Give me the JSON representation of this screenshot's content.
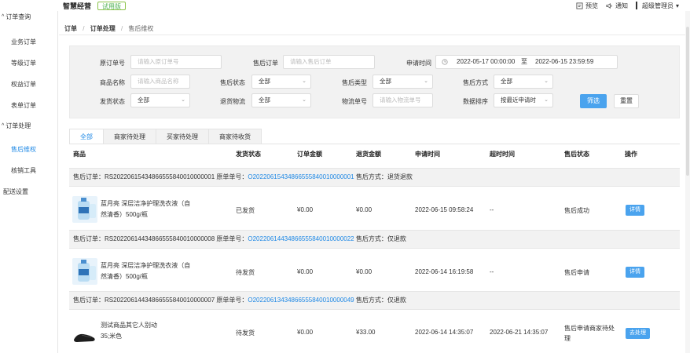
{
  "header": {
    "brand": "智慧经营",
    "trial_badge": "试用版",
    "preview": "预览",
    "notify": "通知",
    "user": "超级管理员",
    "caret": "▾"
  },
  "sidebar": {
    "groups": [
      {
        "label": "订单查询",
        "caret": "^"
      },
      {
        "label": "订单处理",
        "caret": "^"
      }
    ],
    "items_order_query": [
      "业务订单",
      "等级订单",
      "权益订单",
      "表单订单"
    ],
    "items_order_process": [
      "售后维权",
      "核销工具"
    ],
    "active": "售后维权",
    "extra": "配送设置"
  },
  "breadcrumb": {
    "level1": "订单",
    "level2": "订单处理",
    "level3": "售后维权",
    "separator": "/"
  },
  "filters": {
    "original_order_label": "原订单号",
    "original_order_placeholder": "请输入原订单号",
    "aftersale_order_label": "售后订单",
    "aftersale_order_placeholder": "请输入售后订单",
    "apply_time_label": "申请时间",
    "date_start": "2022-05-17 00:00:00",
    "date_sep": "至",
    "date_end": "2022-06-15 23:59:59",
    "product_name_label": "商品名称",
    "product_name_placeholder": "请输入商品名称",
    "aftersale_status_label": "售后状态",
    "aftersale_status_value": "全部",
    "aftersale_type_label": "售后类型",
    "aftersale_type_value": "全部",
    "aftersale_method_label": "售后方式",
    "aftersale_method_value": "全部",
    "ship_status_label": "发货状态",
    "ship_status_value": "全部",
    "return_logistics_label": "退货物流",
    "return_logistics_value": "全部",
    "logistics_no_label": "物流单号",
    "logistics_no_placeholder": "请输入物流单号",
    "sort_label": "数据排序",
    "sort_value": "按最近申请时",
    "filter_button": "筛选",
    "reset_button": "重置",
    "chevron": "⌄"
  },
  "tabs": [
    "全部",
    "商家待处理",
    "买家待处理",
    "商家待收货"
  ],
  "table": {
    "headers": [
      "商品",
      "发货状态",
      "订单金额",
      "退货金额",
      "申请时间",
      "超时时间",
      "售后状态",
      "操作"
    ],
    "groups": [
      {
        "aftersale_label": "售后订单：",
        "aftersale_no": "RS20220615434866555840010000001",
        "orig_label": "原单单号：",
        "orig_no": "O20220615434866555840010000001",
        "method_label": "售后方式：",
        "method": "退货退款",
        "product": "蓝月亮 深层洁净护理洗衣液（自然清香）500g/瓶",
        "ship_status": "已发货",
        "order_amount": "¥0.00",
        "refund_amount": "¥0.00",
        "apply_time": "2022-06-15 09:58:24",
        "timeout": "--",
        "status": "售后成功",
        "action": "详情"
      },
      {
        "aftersale_label": "售后订单：",
        "aftersale_no": "RS20220614434866555840010000008",
        "orig_label": "原单单号：",
        "orig_no": "O20220614434866555840010000022",
        "method_label": "售后方式：",
        "method": "仅退款",
        "product": "蓝月亮 深层洁净护理洗衣液（自然清香）500g/瓶",
        "ship_status": "待发货",
        "order_amount": "¥0.00",
        "refund_amount": "¥0.00",
        "apply_time": "2022-06-14 16:19:58",
        "timeout": "--",
        "status": "售后申请",
        "action": "详情"
      },
      {
        "aftersale_label": "售后订单：",
        "aftersale_no": "RS20220614434866555840010000007",
        "orig_label": "原单单号：",
        "orig_no": "O20220613434866555840010000049",
        "method_label": "售后方式：",
        "method": "仅退款",
        "product": "测试商品其它人别动",
        "product_spec": "35;米色",
        "ship_status": "待发货",
        "order_amount": "¥0.00",
        "refund_amount": "¥33.00",
        "apply_time": "2022-06-14 14:35:07",
        "timeout": "2022-06-21 14:35:07",
        "status": "售后申请商家待处理",
        "action": "去处理"
      }
    ]
  }
}
